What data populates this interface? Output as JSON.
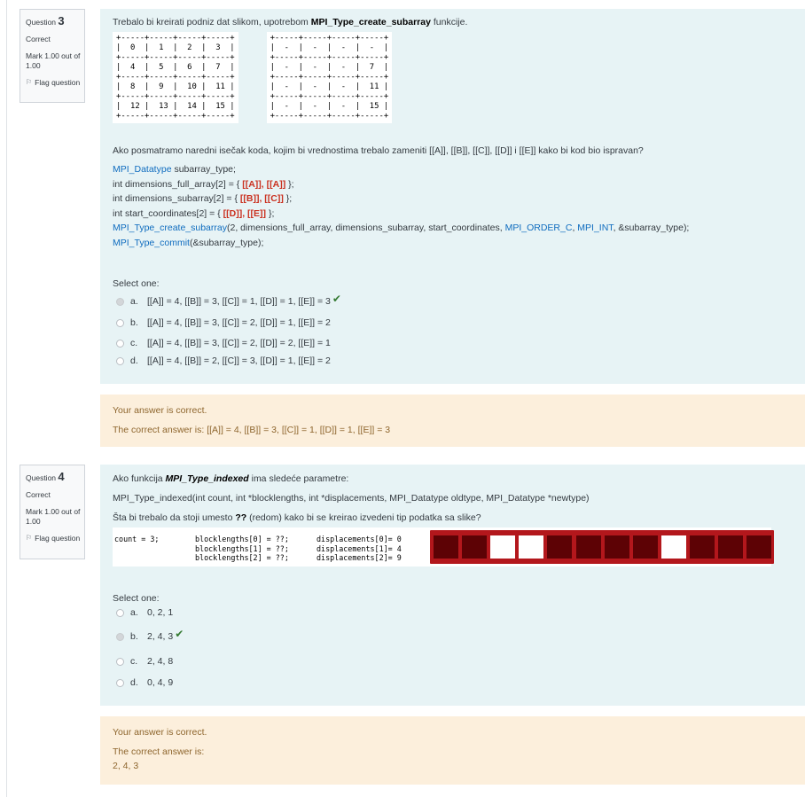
{
  "q3": {
    "info": {
      "question_label": "Question",
      "number": "3",
      "state": "Correct",
      "mark": "Mark 1.00 out of 1.00",
      "flag": "Flag question",
      "flag_icon": "flag-icon"
    },
    "text_pre": "Trebalo bi kreirati podniz dat slikom, upotrebom ",
    "text_bold": "MPI_Type_create_subarray",
    "text_post": " funkcije.",
    "grid_full": "+-----+-----+-----+-----+\n|  0  |  1  |  2  |  3  |\n+-----+-----+-----+-----+\n|  4  |  5  |  6  |  7  |\n+-----+-----+-----+-----+\n|  8  |  9  |  10 |  11 |\n+-----+-----+-----+-----+\n|  12 |  13 |  14 |  15 |\n+-----+-----+-----+-----+",
    "grid_sub": "+-----+-----+-----+-----+\n|  -  |  -  |  -  |  -  |\n+-----+-----+-----+-----+\n|  -  |  -  |  -  |  7  |\n+-----+-----+-----+-----+\n|  -  |  -  |  -  |  11 |\n+-----+-----+-----+-----+\n|  -  |  -  |  -  |  15 |\n+-----+-----+-----+-----+",
    "prompt": "Ako posmatramo naredni isečak koda, kojim bi vrednostima trebalo zameniti [[A]], [[B]], [[C]], [[D]] i [[E]] kako bi kod bio ispravan?",
    "code": {
      "l1_fn": "MPI_Datatype",
      "l1_rest": " subarray_type;",
      "l2_a": "int dimensions_full_array[2] = { ",
      "l2_ph": "[[A]], [[A]]",
      "l2_b": " };",
      "l3_a": "int dimensions_subarray[2] = { ",
      "l3_ph": "[[B]], [[C]]",
      "l3_b": " };",
      "l4_a": "int start_coordinates[2] = { ",
      "l4_ph": "[[D]], [[E]]",
      "l4_b": " };",
      "l5_fn": "MPI_Type_create_subarray",
      "l5_a": "(2, dimensions_full_array, dimensions_subarray, start_coordinates, ",
      "l5_fn2": "MPI_ORDER_C",
      "l5_sep": ", ",
      "l5_fn3": "MPI_INT",
      "l5_b": ", &subarray_type);",
      "l6_fn": "MPI_Type_commit",
      "l6_rest": "(&subarray_type);"
    },
    "select_one": "Select one:",
    "options": [
      {
        "letter": "a.",
        "text": "[[A]] = 4, [[B]] = 3, [[C]] = 1, [[D]] = 1, [[E]] = 3"
      },
      {
        "letter": "b.",
        "text": "[[A]] = 4, [[B]] = 3, [[C]] = 2, [[D]] = 1, [[E]] = 2"
      },
      {
        "letter": "c.",
        "text": "[[A]] = 4, [[B]] = 3, [[C]] = 2, [[D]] = 2, [[E]] = 1"
      },
      {
        "letter": "d.",
        "text": "[[A]] = 4, [[B]] = 2, [[C]] = 3, [[D]] = 1, [[E]] = 2"
      }
    ],
    "selected": "a",
    "feedback": "Your answer is correct.",
    "correct_answer": "The correct answer is: [[A]] = 4, [[B]] = 3, [[C]] = 1, [[D]] = 1, [[E]] = 3"
  },
  "q4": {
    "info": {
      "question_label": "Question",
      "number": "4",
      "state": "Correct",
      "mark": "Mark 1.00 out of 1.00",
      "flag": "Flag question",
      "flag_icon": "flag-icon"
    },
    "text_pre": "Ako funkcija ",
    "text_bold": "MPI_Type_indexed",
    "text_post": " ima sledeće parametre:",
    "signature": "MPI_Type_indexed(int count, int *blocklengths, int *displacements, MPI_Datatype oldtype, MPI_Datatype *newtype)",
    "question_pre": "Šta bi trebalo da stoji umesto ",
    "question_bold": "??",
    "question_post": " (redom) kako bi se kreirao izvedeni tip podatka sa slike?",
    "code_count": "count = 3;",
    "code_block": "blocklengths[0] = ??;\nblocklengths[1] = ??;\nblocklengths[2] = ??;",
    "code_disp": "displacements[0]= 0\ndisplacements[1]= 4\ndisplacements[2]= 9",
    "cells": [
      1,
      1,
      0,
      0,
      1,
      1,
      1,
      1,
      0,
      1,
      1,
      1
    ],
    "select_one": "Select one:",
    "options": [
      {
        "letter": "a.",
        "text": "0, 2, 1"
      },
      {
        "letter": "b.",
        "text": "2, 4, 3"
      },
      {
        "letter": "c.",
        "text": "2, 4, 8"
      },
      {
        "letter": "d.",
        "text": "0, 4, 9"
      }
    ],
    "selected": "b",
    "feedback": "Your answer is correct.",
    "correct_answer_label": "The correct answer is:",
    "correct_answer": "2, 4, 3"
  },
  "colors": {
    "question_bg": "#e7f3f5",
    "feedback_bg": "#fcefdc",
    "feedback_text": "#8e662e",
    "link": "#0f6cbf",
    "placeholder": "#ca3120",
    "check": "#357a32",
    "block_red": "#b3171c",
    "block_dark": "#5d0205"
  }
}
